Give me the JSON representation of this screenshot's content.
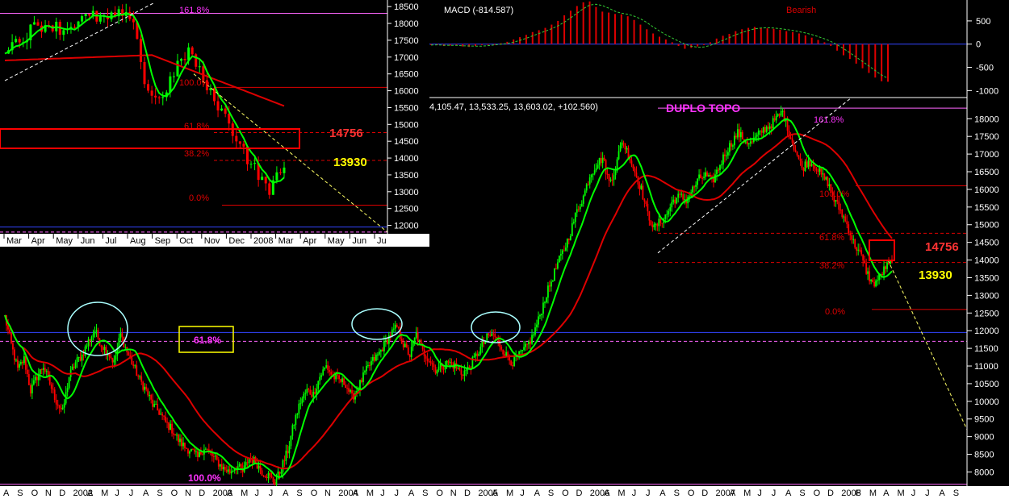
{
  "chart_data": [
    {
      "id": "main",
      "type": "candlestick",
      "x_labels": [
        "A",
        "S",
        "O",
        "N",
        "D",
        "2002",
        "F",
        "M",
        "A",
        "M",
        "J",
        "J",
        "A",
        "S",
        "O",
        "N",
        "D",
        "2003",
        "F",
        "M",
        "A",
        "M",
        "J",
        "J",
        "A",
        "S",
        "O",
        "N",
        "D",
        "2004",
        "F",
        "M",
        "A",
        "M",
        "J",
        "J",
        "A",
        "S",
        "O",
        "N",
        "D",
        "2005",
        "F",
        "M",
        "A",
        "M",
        "J",
        "J",
        "A",
        "S",
        "O",
        "N",
        "D",
        "2006",
        "F",
        "M",
        "A",
        "M",
        "J",
        "J",
        "A",
        "S",
        "O",
        "N",
        "D",
        "2007",
        "F",
        "M",
        "A",
        "M",
        "J",
        "J",
        "A",
        "S",
        "O",
        "N",
        "D",
        "2008",
        "F",
        "M",
        "A",
        "M",
        "J",
        "J",
        "A",
        "S"
      ],
      "x_labels_visible": [
        "A",
        "S",
        "O",
        "N",
        "D",
        "2002",
        "A",
        "M",
        "J",
        "J",
        "A",
        "S",
        "O",
        "N",
        "D",
        "2003",
        "A",
        "M",
        "J",
        "J",
        "A",
        "S",
        "O",
        "N",
        "2004",
        "A",
        "M",
        "J",
        "J",
        "A",
        "S",
        "O",
        "N",
        "D",
        "2005",
        "A",
        "M",
        "J",
        "A",
        "S",
        "O",
        "D",
        "2006",
        "A",
        "M",
        "J",
        "J",
        "A",
        "S",
        "O",
        "D",
        "2007",
        "A",
        "M",
        "J",
        "J",
        "A",
        "S",
        "O",
        "D",
        "2008",
        "F",
        "M",
        "A",
        "M",
        "J",
        "J",
        "A",
        "S"
      ],
      "y_ticks": [
        8000,
        8500,
        9000,
        9500,
        10000,
        10500,
        11000,
        11500,
        12000,
        12500,
        13000,
        13500,
        14000,
        14500,
        15000,
        15500,
        16000,
        16500,
        17000,
        17500,
        18000
      ],
      "ylim": [
        7600,
        18600
      ],
      "close_series": [
        [
          0,
          12400
        ],
        [
          4,
          11600
        ],
        [
          8,
          10900
        ],
        [
          12,
          11200
        ],
        [
          16,
          10300
        ],
        [
          20,
          10700
        ],
        [
          24,
          11000
        ],
        [
          28,
          10500
        ],
        [
          32,
          10000
        ],
        [
          36,
          9700
        ],
        [
          40,
          10700
        ],
        [
          44,
          11100
        ],
        [
          48,
          11300
        ],
        [
          52,
          11700
        ],
        [
          56,
          12000
        ],
        [
          60,
          11600
        ],
        [
          64,
          11400
        ],
        [
          68,
          11100
        ],
        [
          72,
          11900
        ],
        [
          76,
          11400
        ],
        [
          80,
          11000
        ],
        [
          84,
          10600
        ],
        [
          88,
          10300
        ],
        [
          92,
          9900
        ],
        [
          96,
          9700
        ],
        [
          100,
          9400
        ],
        [
          104,
          9200
        ],
        [
          108,
          8900
        ],
        [
          112,
          8700
        ],
        [
          116,
          8600
        ],
        [
          120,
          8400
        ],
        [
          124,
          8700
        ],
        [
          128,
          8500
        ],
        [
          132,
          8300
        ],
        [
          136,
          8100
        ],
        [
          140,
          8000
        ],
        [
          144,
          8200
        ],
        [
          148,
          8000
        ],
        [
          152,
          8400
        ],
        [
          156,
          8300
        ],
        [
          160,
          8000
        ],
        [
          164,
          7900
        ],
        [
          168,
          7700
        ],
        [
          172,
          8100
        ],
        [
          176,
          8600
        ],
        [
          180,
          9400
        ],
        [
          184,
          10000
        ],
        [
          188,
          10300
        ],
        [
          192,
          10200
        ],
        [
          196,
          10700
        ],
        [
          200,
          11000
        ],
        [
          204,
          10700
        ],
        [
          208,
          10600
        ],
        [
          212,
          10500
        ],
        [
          216,
          10100
        ],
        [
          220,
          10400
        ],
        [
          224,
          10800
        ],
        [
          228,
          11100
        ],
        [
          232,
          11300
        ],
        [
          236,
          11600
        ],
        [
          240,
          11900
        ],
        [
          244,
          12100
        ],
        [
          248,
          11600
        ],
        [
          252,
          11300
        ],
        [
          256,
          11900
        ],
        [
          260,
          11400
        ],
        [
          264,
          11200
        ],
        [
          268,
          10900
        ],
        [
          272,
          11000
        ],
        [
          276,
          11100
        ],
        [
          280,
          11000
        ],
        [
          284,
          10800
        ],
        [
          288,
          10900
        ],
        [
          292,
          11200
        ],
        [
          296,
          11500
        ],
        [
          300,
          11800
        ],
        [
          304,
          11900
        ],
        [
          308,
          11600
        ],
        [
          312,
          11300
        ],
        [
          316,
          11100
        ],
        [
          320,
          11300
        ],
        [
          324,
          11500
        ],
        [
          328,
          11800
        ],
        [
          332,
          12300
        ],
        [
          336,
          12900
        ],
        [
          340,
          13400
        ],
        [
          344,
          13900
        ],
        [
          348,
          14300
        ],
        [
          352,
          14800
        ],
        [
          356,
          15400
        ],
        [
          360,
          15800
        ],
        [
          364,
          16400
        ],
        [
          368,
          16700
        ],
        [
          372,
          16900
        ],
        [
          376,
          16200
        ],
        [
          380,
          16600
        ],
        [
          384,
          17400
        ],
        [
          388,
          17000
        ],
        [
          392,
          16500
        ],
        [
          396,
          16000
        ],
        [
          400,
          15300
        ],
        [
          404,
          14900
        ],
        [
          408,
          15100
        ],
        [
          412,
          15300
        ],
        [
          416,
          15700
        ],
        [
          420,
          15800
        ],
        [
          424,
          15700
        ],
        [
          428,
          16000
        ],
        [
          432,
          16300
        ],
        [
          436,
          16400
        ],
        [
          440,
          16200
        ],
        [
          444,
          16600
        ],
        [
          448,
          17000
        ],
        [
          452,
          17300
        ],
        [
          456,
          17600
        ],
        [
          460,
          17400
        ],
        [
          464,
          17300
        ],
        [
          468,
          17500
        ],
        [
          472,
          17700
        ],
        [
          476,
          17800
        ],
        [
          480,
          18000
        ],
        [
          484,
          18200
        ],
        [
          488,
          17600
        ],
        [
          492,
          17100
        ],
        [
          496,
          16600
        ],
        [
          500,
          16800
        ],
        [
          504,
          16700
        ],
        [
          508,
          16400
        ],
        [
          512,
          16200
        ],
        [
          516,
          15700
        ],
        [
          520,
          15400
        ],
        [
          524,
          15000
        ],
        [
          528,
          14500
        ],
        [
          532,
          14200
        ],
        [
          536,
          13700
        ],
        [
          540,
          13300
        ],
        [
          544,
          13500
        ],
        [
          548,
          13800
        ],
        [
          552,
          13900
        ]
      ],
      "series": [
        {
          "name": "",
          "color": "#00ff00"
        },
        {
          "name": "",
          "color": "#dd0000"
        }
      ],
      "horizontal_lines": [
        {
          "value": 11950,
          "color": "#3344ff",
          "style": "solid"
        },
        {
          "value": 11700,
          "color": "#ff66ff",
          "style": "dashed"
        },
        {
          "value": 7650,
          "color": "#ff66ff",
          "style": "solid"
        },
        {
          "value": 18300,
          "color": "#ff66ff",
          "style": "solid"
        },
        {
          "value": 16100,
          "color": "#dd0000",
          "style": "solid"
        },
        {
          "value": 14756,
          "color": "#dd0000",
          "style": "dashed"
        },
        {
          "value": 13930,
          "color": "#dd0000",
          "style": "dashed"
        },
        {
          "value": 12600,
          "color": "#dd0000",
          "style": "solid"
        }
      ],
      "annotations": {
        "double_top": "DUPLO TOPO",
        "fib_main": "61.8%",
        "fib_base": "100.0%",
        "fib_top": "161.8%",
        "fib_100": "100.0%",
        "fib_618": "61.8%",
        "fib_382": "38.2%",
        "fib_0": "0.0%",
        "level_high": "14756",
        "level_low": "13930",
        "ohlc_header": "4,105.47, 13,533.25, 13,603.02, +102.560)"
      }
    },
    {
      "id": "inset",
      "type": "candlestick",
      "x_labels": [
        "Mar",
        "Apr",
        "May",
        "Jun",
        "Jul",
        "Aug",
        "Sep",
        "Oct",
        "Nov",
        "Dec",
        "2008",
        "Mar",
        "Apr",
        "May",
        "Jun",
        "Ju"
      ],
      "y_ticks": [
        12000,
        12500,
        13000,
        13500,
        14000,
        14500,
        15000,
        15500,
        16000,
        16500,
        17000,
        17500,
        18000,
        18500
      ],
      "ylim": [
        11750,
        18600
      ],
      "close_series": [
        [
          0,
          17300
        ],
        [
          4,
          17500
        ],
        [
          8,
          17900
        ],
        [
          12,
          18000
        ],
        [
          16,
          17800
        ],
        [
          20,
          18100
        ],
        [
          24,
          18200
        ],
        [
          28,
          18100
        ],
        [
          32,
          18300
        ],
        [
          36,
          17700
        ],
        [
          38,
          16200
        ],
        [
          40,
          15900
        ],
        [
          42,
          15700
        ],
        [
          44,
          16100
        ],
        [
          46,
          16500
        ],
        [
          48,
          16900
        ],
        [
          50,
          17200
        ],
        [
          52,
          16800
        ],
        [
          54,
          16300
        ],
        [
          56,
          15900
        ],
        [
          58,
          15600
        ],
        [
          60,
          15200
        ],
        [
          62,
          14800
        ],
        [
          64,
          14500
        ],
        [
          66,
          14000
        ],
        [
          68,
          13700
        ],
        [
          70,
          13300
        ],
        [
          72,
          13100
        ],
        [
          74,
          13400
        ],
        [
          76,
          13650
        ]
      ],
      "y_ticks_labels_visible": true,
      "annotations": {
        "fib_top": "161.8%",
        "fib_100": "100.0%",
        "fib_618": "61.8%",
        "fib_382": "38.2%",
        "fib_0": "0.0%",
        "level_high": "14756",
        "level_low": "13930"
      }
    },
    {
      "id": "macd",
      "type": "bar",
      "title": "MACD (-814.587)",
      "signal": "Bearish",
      "y_ticks": [
        500,
        0,
        -500,
        -1000
      ],
      "ylim": [
        -1150,
        950
      ],
      "values": [
        -20,
        -10,
        -40,
        -30,
        -20,
        -50,
        -60,
        -40,
        -20,
        -10,
        0,
        20,
        50,
        100,
        150,
        200,
        260,
        300,
        350,
        420,
        500,
        620,
        720,
        820,
        900,
        920,
        800,
        700,
        680,
        650,
        640,
        600,
        520,
        420,
        320,
        230,
        160,
        100,
        40,
        -40,
        -100,
        -80,
        -50,
        -20,
        40,
        120,
        180,
        220,
        280,
        320,
        350,
        370,
        350,
        340,
        330,
        310,
        280,
        260,
        230,
        190,
        140,
        90,
        40,
        -40,
        -140,
        -240,
        -320,
        -420,
        -520,
        -620,
        -720,
        -800,
        -810
      ]
    }
  ]
}
